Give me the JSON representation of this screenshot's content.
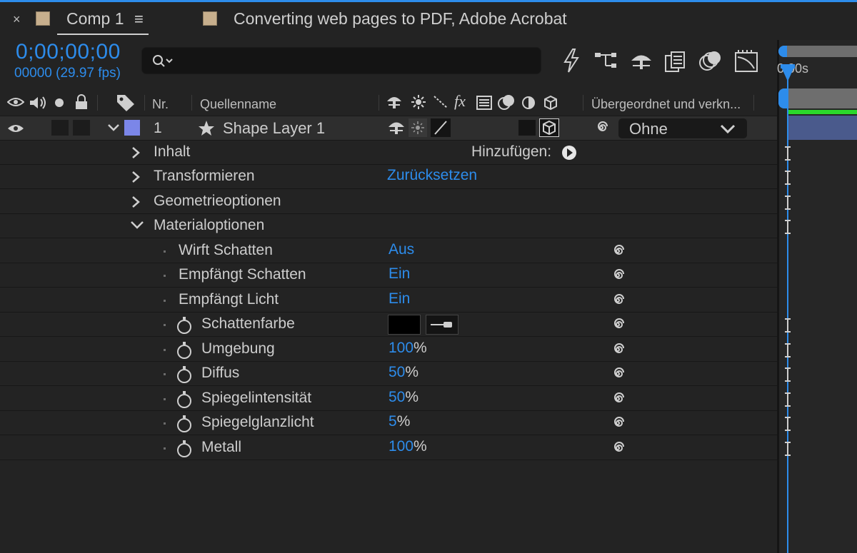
{
  "tabs": {
    "comp_tab": {
      "close": "×",
      "label": "Comp 1",
      "menu": "≡"
    },
    "other_tab": {
      "label": "Converting web pages to PDF, Adobe Acrobat"
    }
  },
  "time": {
    "timecode": "0;00;00;00",
    "frames": "00000 (29.97 fps)"
  },
  "search": {
    "placeholder": ""
  },
  "toolbar_icons": [
    "lightning-icon",
    "flowchart-icon",
    "draft-3d-icon",
    "frame-blending-icon",
    "motion-blur-icon",
    "graph-editor-icon"
  ],
  "header": {
    "nr": "Nr.",
    "source_name": "Quellenname",
    "fx": "fx",
    "parent": "Übergeordnet und verkn..."
  },
  "layer": {
    "number": "1",
    "name": "Shape Layer 1",
    "label_color": "#7b86e8",
    "parent_value": "Ohne"
  },
  "groups": [
    {
      "label": "Inhalt",
      "expanded": false
    },
    {
      "label": "Transformieren",
      "expanded": false,
      "value": "Zurücksetzen"
    },
    {
      "label": "Geometrieoptionen",
      "expanded": false
    },
    {
      "label": "Materialoptionen",
      "expanded": true
    }
  ],
  "add_label": "Hinzufügen:",
  "properties": [
    {
      "label": "Wirft Schatten",
      "value": "Aus",
      "unit": ""
    },
    {
      "label": "Empfängt Schatten",
      "value": "Ein",
      "unit": ""
    },
    {
      "label": "Empfängt Licht",
      "value": "Ein",
      "unit": ""
    },
    {
      "label": "Schattenfarbe",
      "swatch": "#000000"
    },
    {
      "label": "Umgebung",
      "value": "100",
      "unit": "%"
    },
    {
      "label": "Diffus",
      "value": "50",
      "unit": "%"
    },
    {
      "label": "Spiegelintensität",
      "value": "50",
      "unit": "%"
    },
    {
      "label": "Spiegelglanzlicht",
      "value": "5",
      "unit": "%"
    },
    {
      "label": "Metall",
      "value": "100",
      "unit": "%"
    }
  ],
  "timeline": {
    "ruler_label": "0:00s"
  },
  "colors": {
    "accent": "#2d8ceb",
    "workarea_green": "#2bd82b",
    "layer_bar": "#4a5a8c"
  }
}
